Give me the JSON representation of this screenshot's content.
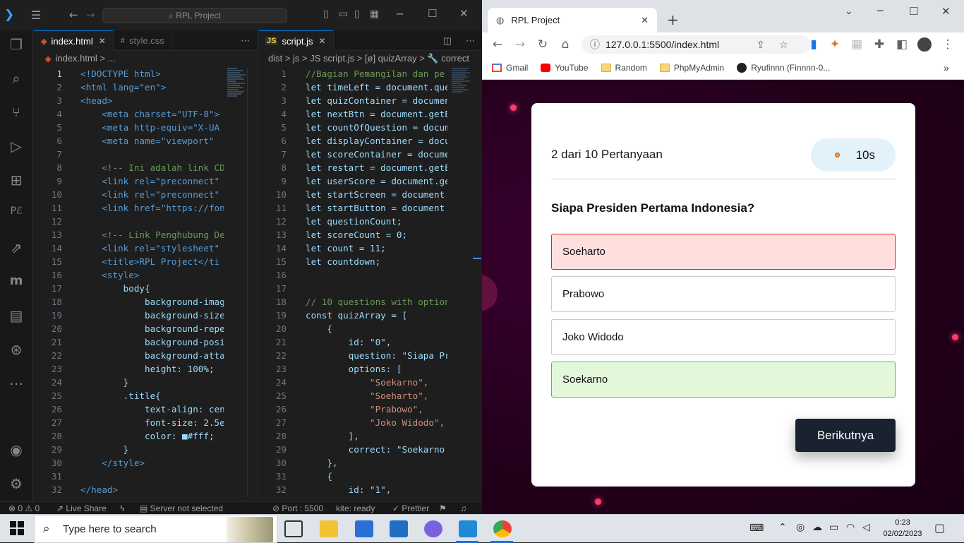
{
  "vscode": {
    "search_text": "RPL Project",
    "left_tabs": [
      "index.html",
      "style.css"
    ],
    "left_crumb": "index.html > ...",
    "right_tab": "script.js",
    "right_crumb": "dist > js > JS script.js > [ø] quizArray > 🔧 correct",
    "left_lines": [
      "<!DOCTYPE html>",
      "<html lang=\"en\">",
      "<head>",
      "    <meta charset=\"UTF-8\">",
      "    <meta http-equiv=\"X-UA",
      "    <meta name=\"viewport\" ",
      "",
      "    <!-- Ini adalah link CD",
      "    <link rel=\"preconnect\"",
      "    <link rel=\"preconnect\"",
      "    <link href=\"https://fon",
      "",
      "    <!-- Link Penghubung De",
      "    <link rel=\"stylesheet\"",
      "    <title>RPL Project</ti",
      "    <style>",
      "        body{",
      "            background-imag",
      "            background-size",
      "            background-repe",
      "            background-posi",
      "            background-atta",
      "            height: 100%;",
      "        }",
      "        .title{",
      "            text-align: cen",
      "            font-size: 2.5e",
      "            color: ■#fff;",
      "        }",
      "    </style>",
      "",
      "</head>"
    ],
    "right_lines": [
      "//Bagian Pemangilan dan pe",
      "let timeLeft = document.que",
      "let quizContainer = documen",
      "let nextBtn = document.getE",
      "let countOfQuestion = docum",
      "let displayContainer = docu",
      "let scoreContainer = docume",
      "let restart = document.getE",
      "let userScore = document.ge",
      "let startScreen = document",
      "let startButton = document",
      "let questionCount;",
      "let scoreCount = 0;",
      "let count = 11;",
      "let countdown;",
      "",
      "",
      "// 10 questions with option",
      "const quizArray = [",
      "    {",
      "        id: \"0\",",
      "        question: \"Siapa Pr",
      "        options: [",
      "            \"Soekarno\",",
      "            \"Soeharto\",",
      "            \"Prabowo\",",
      "            \"Joko Widodo\",",
      "        ],",
      "        correct: \"Soekarno",
      "    },",
      "    {",
      "        id: \"1\","
    ],
    "status": {
      "errors": "⊗ 0 ⚠ 0",
      "live_share": "Live Share",
      "server": "Server not selected",
      "port": "⊘ Port : 5500",
      "kite": "kite: ready",
      "prettier": "✓ Prettier"
    }
  },
  "chrome": {
    "tab_title": "RPL Project",
    "url": "127.0.0.1:5500/index.html",
    "bookmarks": [
      "Gmail",
      "YouTube",
      "Random",
      "PhpMyAdmin",
      "Ryufinnn (Finnnn-0..."
    ]
  },
  "quiz": {
    "count_text": "2 dari 10 Pertanyaan",
    "timer": "10s",
    "question": "Siapa Presiden Pertama Indonesia?",
    "options": [
      {
        "label": "Soeharto",
        "state": "wrong"
      },
      {
        "label": "Prabowo",
        "state": "none"
      },
      {
        "label": "Joko Widodo",
        "state": "none"
      },
      {
        "label": "Soekarno",
        "state": "correct"
      }
    ],
    "next_label": "Berikutnya"
  },
  "taskbar": {
    "search_placeholder": "Type here to search",
    "time": "0:23",
    "date": "02/02/2023"
  }
}
